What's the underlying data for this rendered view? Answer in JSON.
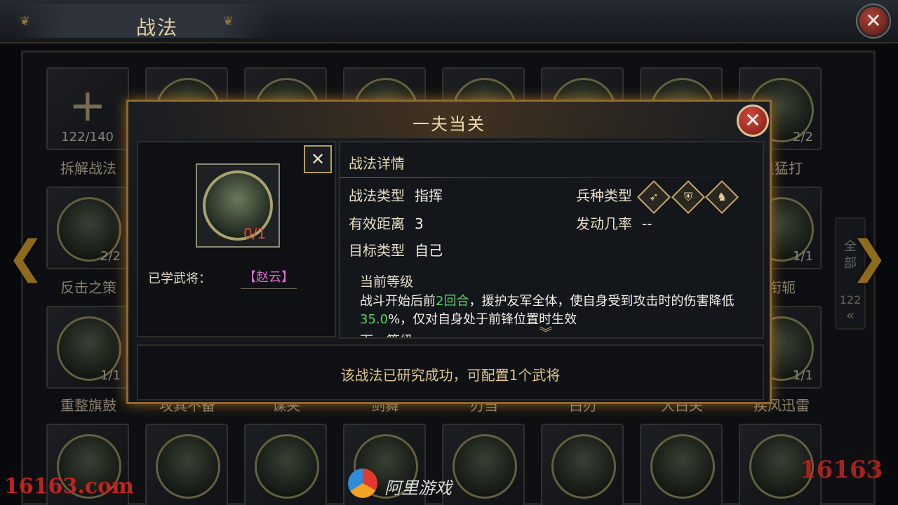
{
  "header": {
    "title": "战法"
  },
  "grid": {
    "slots_row1": [
      {
        "count": "122/140",
        "label": "拆解战法"
      },
      {
        "count": "",
        "label": ""
      },
      {
        "count": "",
        "label": ""
      },
      {
        "count": "",
        "label": ""
      },
      {
        "count": "",
        "label": ""
      },
      {
        "count": "",
        "label": ""
      },
      {
        "count": "",
        "label": ""
      },
      {
        "count": "2/2",
        "label": "皇猛打"
      }
    ],
    "slots_row2": [
      {
        "count": "2/2",
        "label": "反击之策"
      },
      {
        "count": "1/1",
        "label": "衔轭"
      }
    ],
    "slots_row3": [
      {
        "count": "1/1",
        "label": "重整旗鼓"
      },
      {
        "count": "1/1",
        "label": "疾风迅雷"
      }
    ],
    "row3_partial_labels": [
      "攻其不备",
      "谋夹",
      "剑舞",
      "刃当",
      "白刃",
      "大白关"
    ]
  },
  "filter": {
    "line1": "全",
    "line2": "部",
    "count": "122",
    "chevron": "«"
  },
  "modal": {
    "title": "一夫当关",
    "skill_count": "0/1",
    "learned_label": "已学武将：",
    "learned_value": "【赵云】",
    "details_title": "战法详情",
    "type_key": "战法类型",
    "type_value": "指挥",
    "range_key": "有效距离",
    "range_value": "3",
    "target_key": "目标类型",
    "target_value": "自己",
    "troop_key": "兵种类型",
    "troop_icons": [
      "bow-icon",
      "shield-icon",
      "horse-icon"
    ],
    "rate_key": "发动几率",
    "rate_value": "--",
    "current_level_title": "当前等级",
    "desc_part1": "战斗开始后前",
    "desc_highlight1": "2回合",
    "desc_part2": "，援护友军全体，使自身受到攻击时的伤害降低",
    "desc_highlight2": "35.0",
    "desc_part3": "%，仅对自身处于前锋位置时生效",
    "next_level_title": "下一等级",
    "footer_text": "该战法已研究成功，可配置1个武将"
  },
  "watermarks": {
    "left": "16163.com",
    "center": "阿里游戏",
    "right": "16163"
  }
}
